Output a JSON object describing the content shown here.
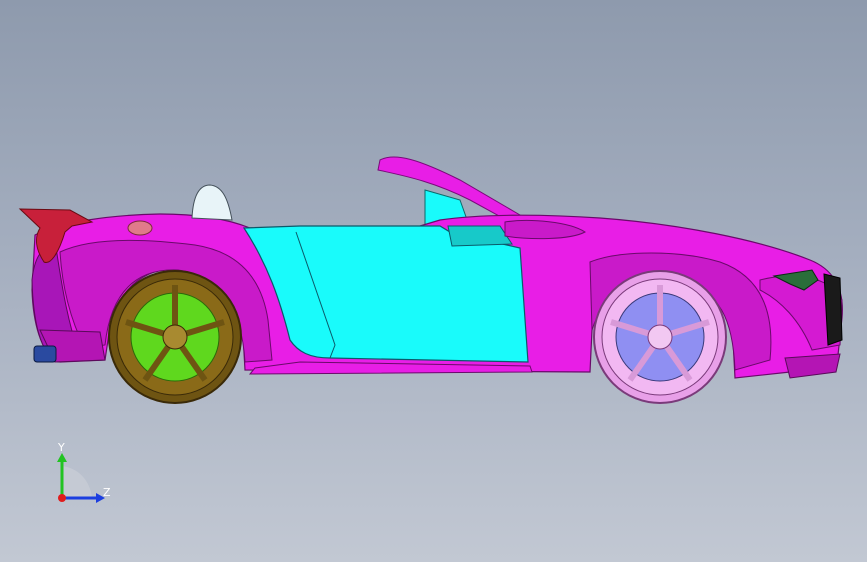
{
  "viewport": {
    "background_top": "#8e9aad",
    "background_bottom": "#c2c8d3"
  },
  "model": {
    "colors": {
      "body": "#e81ee6",
      "body_shade": "#b415b4",
      "door": "#19fbfb",
      "door_shade": "#0fb9c6",
      "rear_wheel_rim": "#8a6a18",
      "rear_brake_disc": "#5fd81e",
      "front_wheel_rim": "#f2b8f2",
      "front_brake_disc": "#8f8ff2",
      "spoiler": "#c8203a",
      "headlight": "#2a6e3a"
    }
  },
  "triad": {
    "y_label": "Y",
    "z_label": "Z",
    "y_color": "#22c322",
    "z_color": "#1c3ee0",
    "x_color": "#e01c1c"
  }
}
